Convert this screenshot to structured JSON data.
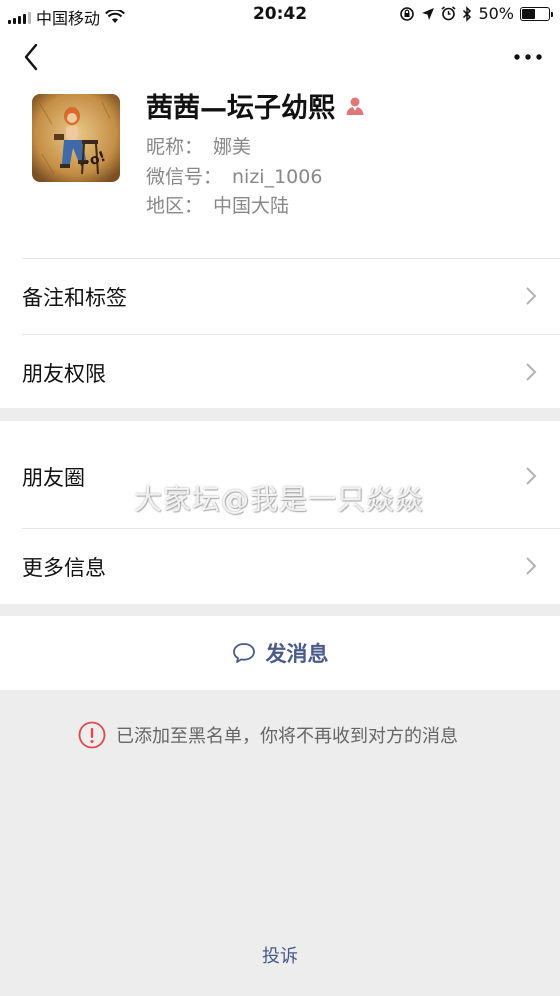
{
  "status_bar": {
    "carrier": "中国移动",
    "time": "20:42",
    "battery": "50%",
    "battery_level": 0.5,
    "icons": [
      "signal-icon",
      "wifi-icon",
      "screen-lock-icon",
      "location-icon",
      "alarm-icon",
      "bluetooth-icon",
      "battery-icon"
    ]
  },
  "nav": {
    "back_icon": "chevron-left-icon",
    "more_icon": "more-dots-icon"
  },
  "profile": {
    "name": "茜茜—坛子幼熙",
    "gender_icon": "female-person-icon",
    "nickname_label": "昵称：",
    "nickname": "娜美",
    "wechat_id_label": "微信号：",
    "wechat_id": "nizi_1006",
    "region_label": "地区：",
    "region": "中国大陆"
  },
  "rows": {
    "remark_tags": "备注和标签",
    "friend_permission": "朋友权限",
    "moments": "朋友圈",
    "more_info": "更多信息"
  },
  "actions": {
    "send_message": "发消息",
    "report": "投诉"
  },
  "notice": {
    "blocked": "已添加至黑名单，你将不再收到对方的消息"
  },
  "watermark": "大家坛@我是一只焱焱",
  "colors": {
    "link": "#4a5b8a",
    "warning": "#e0484b",
    "gender": "#e0787a",
    "background": "#ededed"
  }
}
